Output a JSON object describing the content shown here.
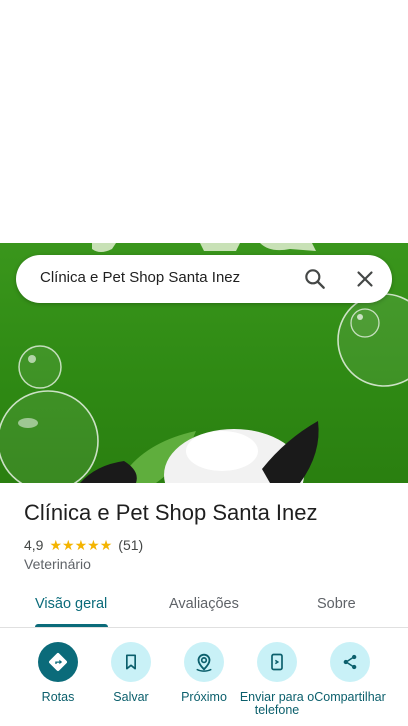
{
  "search": {
    "query": "Clínica e Pet Shop Santa Inez"
  },
  "place": {
    "name": "Clínica e Pet Shop Santa Inez",
    "rating": "4,9",
    "stars": 5,
    "review_count": "(51)",
    "category": "Veterinário"
  },
  "tabs": [
    {
      "label": "Visão geral",
      "active": true
    },
    {
      "label": "Avaliações",
      "active": false
    },
    {
      "label": "Sobre",
      "active": false
    }
  ],
  "actions": [
    {
      "label": "Rotas",
      "icon": "directions-icon"
    },
    {
      "label": "Salvar",
      "icon": "bookmark-icon"
    },
    {
      "label": "Próximo",
      "icon": "nearby-icon"
    },
    {
      "label": "Enviar para o telefone",
      "icon": "send-to-phone-icon"
    },
    {
      "label": "Compartilhar",
      "icon": "share-icon"
    }
  ],
  "colors": {
    "accent": "#0b6b7a",
    "action_bg": "#c9f1f7",
    "star": "#f4b400",
    "hero_green": "#3a961c"
  }
}
